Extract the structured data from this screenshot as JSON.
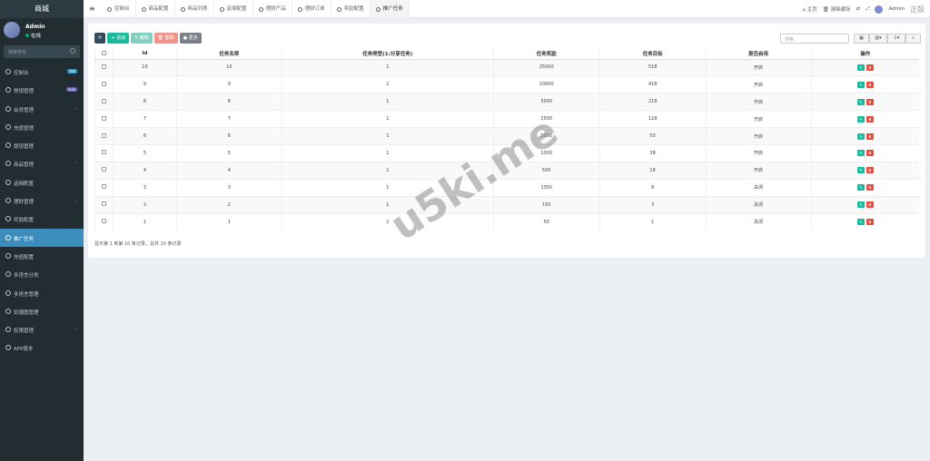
{
  "app": {
    "title": "商城"
  },
  "user": {
    "name": "Admin",
    "status": "在线"
  },
  "sidebar_search": {
    "placeholder": "搜索菜单"
  },
  "sidebar": {
    "items": [
      {
        "label": "控制台",
        "badge": "hot",
        "icon": "dashboard-icon"
      },
      {
        "label": "常规管理",
        "badge": "new",
        "icon": "cogs-icon"
      },
      {
        "label": "会员管理",
        "caret": "‹",
        "icon": "user-circle-icon"
      },
      {
        "label": "充值管理",
        "icon": "circle-icon"
      },
      {
        "label": "提现管理",
        "icon": "yen-icon"
      },
      {
        "label": "商品管理",
        "caret": "‹",
        "icon": "shop-icon"
      },
      {
        "label": "返佣配置",
        "icon": "circle-icon"
      },
      {
        "label": "理财管理",
        "caret": "‹",
        "icon": "list-icon"
      },
      {
        "label": "奖励配置",
        "icon": "gift-icon"
      },
      {
        "label": "推广任务",
        "icon": "link-icon",
        "active": true
      },
      {
        "label": "充值配置",
        "icon": "card-icon"
      },
      {
        "label": "多语言分类",
        "icon": "tag-icon"
      },
      {
        "label": "多语言管理",
        "icon": "language-icon"
      },
      {
        "label": "轮播图管理",
        "icon": "image-icon"
      },
      {
        "label": "权限管理",
        "caret": "‹",
        "icon": "group-icon"
      },
      {
        "label": "APP版本",
        "icon": "circle-icon"
      }
    ]
  },
  "topnav": {
    "tabs": [
      "控制台",
      "商品配置",
      "商品列表",
      "返佣配置",
      "理财产品",
      "理财订单",
      "奖励配置",
      "推广任务"
    ],
    "right": {
      "home": "主页",
      "clear_cache": "清除缓存",
      "user": "Admin",
      "watermark": "正版"
    }
  },
  "toolbar": {
    "refresh": "",
    "add": "添加",
    "edit": "编辑",
    "delete": "删除",
    "more": "更多"
  },
  "table_search": {
    "placeholder": "搜索"
  },
  "table": {
    "headers": [
      "",
      "Id",
      "任务名称",
      "任务类型(1:分享任务)",
      "任务奖励",
      "任务目标",
      "是否启用",
      "操作"
    ],
    "rows": [
      {
        "id": "10",
        "name": "10",
        "type": "1",
        "reward": "25000",
        "target": "518",
        "status": "开启"
      },
      {
        "id": "9",
        "name": "9",
        "type": "1",
        "reward": "10000",
        "target": "418",
        "status": "开启"
      },
      {
        "id": "8",
        "name": "8",
        "type": "1",
        "reward": "5000",
        "target": "218",
        "status": "开启"
      },
      {
        "id": "7",
        "name": "7",
        "type": "1",
        "reward": "2500",
        "target": "118",
        "status": "开启"
      },
      {
        "id": "6",
        "name": "6",
        "type": "1",
        "reward": "1500",
        "target": "50",
        "status": "开启"
      },
      {
        "id": "5",
        "name": "5",
        "type": "1",
        "reward": "1000",
        "target": "38",
        "status": "开启"
      },
      {
        "id": "4",
        "name": "4",
        "type": "1",
        "reward": "500",
        "target": "18",
        "status": "开启"
      },
      {
        "id": "3",
        "name": "3",
        "type": "1",
        "reward": "1350",
        "target": "8",
        "status": "关闭"
      },
      {
        "id": "2",
        "name": "2",
        "type": "1",
        "reward": "150",
        "target": "3",
        "status": "关闭"
      },
      {
        "id": "1",
        "name": "1",
        "type": "1",
        "reward": "50",
        "target": "1",
        "status": "关闭"
      }
    ]
  },
  "footer": {
    "info": "显示第 1 到第 10 条记录，总共 10 条记录"
  },
  "watermark": {
    "text": "u5ki.me"
  }
}
